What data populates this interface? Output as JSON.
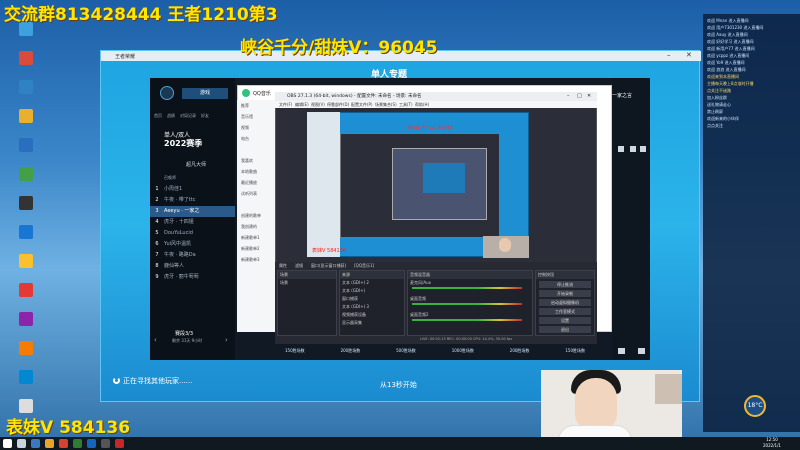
{
  "overlay": {
    "top_text": "交流群813428444 王者1210第3",
    "mid_text": "峡谷千分/甜妹V：96045",
    "bottom_text": "表妹V 584136"
  },
  "game_window": {
    "title": "王者荣耀",
    "heading": "单人专题",
    "season_label": "单人/双人",
    "season_year": "2022赛季",
    "top_button": "游戏",
    "tabs": [
      "首页",
      "战绩",
      "对局记录",
      "好友"
    ],
    "rank_title": "超凡大师",
    "list_header": "召唤师",
    "list": [
      {
        "num": "1",
        "name": "小周佳1"
      },
      {
        "num": "2",
        "name": "午夜 · 带了ttc"
      },
      {
        "num": "3",
        "name": "Aeeyu · 一家之"
      },
      {
        "num": "4",
        "name": "虎牙 · 十四姐"
      },
      {
        "num": "5",
        "name": "DouYuLucid"
      },
      {
        "num": "6",
        "name": "Yui风中温凯"
      },
      {
        "num": "7",
        "name": "午夜 · 路路Da"
      },
      {
        "num": "8",
        "name": "鹿仙等人"
      },
      {
        "num": "9",
        "name": "虎牙 · 丽牛萄萄"
      }
    ],
    "page_info": "赛段3/3",
    "page_sub": "剩余 31天 9小时",
    "right_label": "一家之言",
    "searching": "正在寻找其他玩家......",
    "start_in": "从13秒开始",
    "bottom_counts": [
      "150胜场数",
      "200胜场数",
      "500胜场数",
      "1000胜场数",
      "200胜场数",
      "150胜场数"
    ]
  },
  "qq": {
    "logo": "QQ音乐",
    "items": [
      "推荐",
      "音乐馆",
      "视频",
      "电台",
      "",
      "我喜欢",
      "本地歌曲",
      "最近播放",
      "试听列表",
      "",
      "创建的歌单",
      "我创建的",
      "新建歌单1",
      "新建歌单2",
      "新建歌单3"
    ]
  },
  "obs": {
    "title": "OBS 27.1.3 (64-bit, windows) - 配置文件: 未命名 - 场景: 未命名",
    "menu": [
      "文件(F)",
      "编辑(E)",
      "视图(V)",
      "停靠部件(D)",
      "配置文件(P)",
      "场景集合(S)",
      "工具(T)",
      "帮助(H)"
    ],
    "preview_red": "MIDL 分 VX 96045",
    "source_red": "表妹V 584136",
    "toolbar": [
      "属性",
      "滤镜",
      "窗口(显示窗口捕获)",
      "[QQ音乐1]"
    ],
    "panels": {
      "scenes_title": "场景",
      "scene_items": [
        "场景"
      ],
      "sources_title": "来源",
      "source_items": [
        "文本 (GDI+) 2",
        "文本 (GDI+)",
        "窗口捕获",
        "文本 (GDI+) 3",
        "视频捕获设备",
        "显示器采集"
      ],
      "mixer_title": "音频混音器",
      "mixer_items": [
        "麦克风/Aux",
        "桌面音频",
        "桌面音频2"
      ],
      "controls_title": "控制按钮",
      "controls": [
        "停止推流",
        "开始录制",
        "启动虚拟摄像机",
        "工作室模式",
        "设置",
        "退出"
      ],
      "status": "LIVE: 00:52:13  REC: 00:00:00  CPU: 14.4%, 30.00 fps"
    }
  },
  "chat": [
    "欢迎 Mnan 进入直播间",
    "欢迎 用户7301230 进入直播间",
    "欢迎 Aauy 进入直播间",
    "欢迎 好好学习 进入直播间",
    "欢迎 新用户77 进入直播间",
    "欢迎 ycppz 进入直播间",
    "欢迎 Yo9 进入直播间",
    "欢迎 浪浪 进入直播间",
    "",
    "欢迎来到本直播间",
    "主播每天晚上8点准时开播",
    "点关注不迷路",
    "",
    "加入粉丝群",
    "送礼物请走心",
    "禁止刷屏",
    "",
    "",
    "",
    "欢迎新来的小伙伴",
    "点点关注"
  ],
  "taskbar": {
    "time": "12:50",
    "date": "2022/1/1",
    "weather": "18°C"
  },
  "colors": {
    "overlay_yellow": "#ffe600",
    "game_blue": "#1ea4e0",
    "obs_dark": "#2b2e38"
  }
}
